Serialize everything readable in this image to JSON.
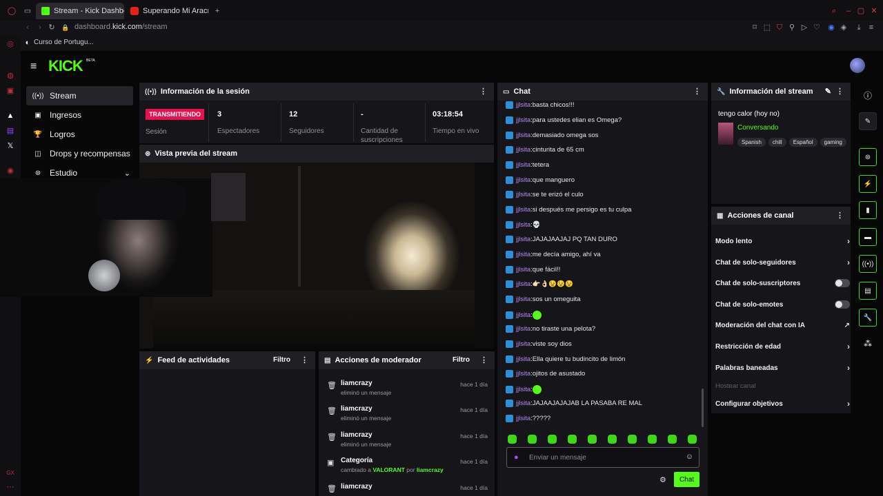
{
  "browser": {
    "tabs": [
      {
        "title": "Stream - Kick Dashboard",
        "active": true
      },
      {
        "title": "Superando Mi Aracnofobi",
        "active": false
      }
    ],
    "url_prefix": "dashboard.",
    "url_domain": "kick.com",
    "url_path": "/stream",
    "bookmark": "Curso de Portugu..."
  },
  "brand": {
    "logo": "KICK",
    "beta": "BETA",
    "accent": "#53fc18"
  },
  "nav": [
    {
      "label": "Stream",
      "icon": "antenna-icon"
    },
    {
      "label": "Ingresos",
      "icon": "dollar-icon"
    },
    {
      "label": "Logros",
      "icon": "trophy-icon"
    },
    {
      "label": "Drops y recompensas",
      "icon": "gift-icon"
    },
    {
      "label": "Estudio",
      "icon": "studio-icon"
    }
  ],
  "session": {
    "title": "Información de la sesión",
    "status": "TRANSMITIENDO",
    "status_label": "Sesión",
    "stats": [
      {
        "value": "3",
        "label": "Espectadores"
      },
      {
        "value": "12",
        "label": "Seguidores"
      },
      {
        "value": "-",
        "label": "Cantidad de suscripciones"
      },
      {
        "value": "03:18:54",
        "label": "Tiempo en vivo"
      }
    ]
  },
  "preview": {
    "title": "Vista previa del stream"
  },
  "feed": {
    "title": "Feed de actividades",
    "filter": "Filtro"
  },
  "mod": {
    "title": "Acciones de moderador",
    "filter": "Filtro",
    "rows": [
      {
        "user": "liamcrazy",
        "action": "eliminó un mensaje",
        "time": "hace 1 día"
      },
      {
        "user": "liamcrazy",
        "action": "eliminó un mensaje",
        "time": "hace 1 día"
      },
      {
        "user": "liamcrazy",
        "action": "eliminó un mensaje",
        "time": "hace 1 día"
      },
      {
        "user": "Categoría",
        "action_prefix": "cambiado a ",
        "game": "VALORANT",
        "by": " por ",
        "mod": "liamcrazy",
        "time": "hace 1 día"
      },
      {
        "user": "liamcrazy",
        "action": "",
        "time": "hace 1 día"
      }
    ]
  },
  "chat": {
    "title": "Chat",
    "messages": [
      {
        "user": "jjlsita",
        "text": "basta chicos!!!"
      },
      {
        "user": "jjlsita",
        "text": "para ustedes elian es Omega?"
      },
      {
        "user": "jjlsita",
        "text": "demasiado omega sos"
      },
      {
        "user": "jjlsita",
        "text": "cinturita de 65 cm"
      },
      {
        "user": "jjlsita",
        "text": "tetera"
      },
      {
        "user": "jjlsita",
        "text": "que manguero"
      },
      {
        "user": "jjlsita",
        "text": "se te erizó el culo"
      },
      {
        "user": "jjlsita",
        "text": "si después me persigo es tu culpa"
      },
      {
        "user": "jjlsita",
        "text": "💀"
      },
      {
        "user": "jjlsita",
        "text": "JAJAJAAJAJ PQ TAN DURO"
      },
      {
        "user": "jjlsita",
        "text": "me decía amigo, ahí va"
      },
      {
        "user": "jjlsita",
        "text": "que fácil!!"
      },
      {
        "user": "jjlsita",
        "text": "👉🏻👌🏻😉😉😉"
      },
      {
        "user": "jjlsita",
        "text": "sos un omeguita"
      },
      {
        "user": "jjlsita",
        "text": ""
      },
      {
        "user": "jjlsita",
        "text": "no tiraste una pelota?"
      },
      {
        "user": "jjlsita",
        "text": "viste soy dios"
      },
      {
        "user": "jjlsita",
        "text": "Ella quiere tu budincito de limón"
      },
      {
        "user": "jjlsita",
        "text": "ojitos de asustado"
      },
      {
        "user": "jjlsita",
        "text": ""
      },
      {
        "user": "jjlsita",
        "text": "JAJAAJAJAJAB LA PASABA RE MAL"
      },
      {
        "user": "jjlsita",
        "text": "?????"
      }
    ],
    "placeholder": "Enviar un mensaje",
    "send_label": "Chat"
  },
  "stream_info": {
    "title": "Información del stream",
    "stream_title": "tengo calor (hoy no)",
    "category": "Conversando",
    "tags": [
      "Spanish",
      "chill",
      "Español",
      "gaming"
    ]
  },
  "channel_actions": {
    "title": "Acciones de canal",
    "items": [
      {
        "label": "Modo lento",
        "control": "chevron"
      },
      {
        "label": "Chat de solo-seguidores",
        "control": "chevron"
      },
      {
        "label": "Chat de solo-suscriptores",
        "control": "toggle",
        "on": false
      },
      {
        "label": "Chat de solo-emotes",
        "control": "toggle",
        "on": false
      },
      {
        "label": "Moderación del chat con IA",
        "control": "external"
      },
      {
        "label": "Restricción de edad",
        "control": "chevron"
      },
      {
        "label": "Palabras baneadas",
        "control": "chevron"
      },
      {
        "label": "Hostear canal",
        "control": "disabled"
      },
      {
        "label": "Configurar objetivos",
        "control": "chevron"
      }
    ]
  }
}
